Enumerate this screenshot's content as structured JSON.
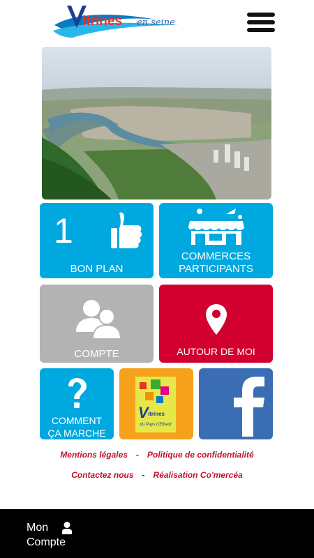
{
  "header": {
    "logo": {
      "brand_letters": [
        "V",
        "itrines"
      ],
      "tagline": "en seine"
    },
    "menu_icon": "hamburger-menu-icon"
  },
  "hero": {
    "image": "aerial-view-seine-valley"
  },
  "tiles": {
    "bon_plan": {
      "number": "1",
      "label": "BON PLAN",
      "icon": "thumbs-up-icon",
      "color": "#00a8e0"
    },
    "commerces": {
      "label_line1": "COMMERCES",
      "label_line2": "PARTICIPANTS",
      "icon": "shops-icon",
      "color": "#00a8e0"
    },
    "compte": {
      "label": "COMPTE",
      "icon": "users-icon",
      "color": "#b3b3b3"
    },
    "autour": {
      "label": "AUTOUR DE MOI",
      "icon": "map-pin-icon",
      "color": "#d2002e"
    },
    "comment": {
      "label_line1": "COMMENT",
      "label_line2": "ÇA MARCHE",
      "icon": "question-mark-icon",
      "color": "#00a8e0"
    },
    "vitrines_pays": {
      "logo_initial": "V",
      "logo_text": "itrines",
      "logo_sub": "du Pays d'Elbeuf",
      "color": "#f6a11a"
    },
    "facebook": {
      "icon": "facebook-icon",
      "color": "#3b6db5"
    }
  },
  "links": {
    "mentions": "Mentions légales",
    "sep": "-",
    "privacy": "Politique de confidentialité",
    "contact": "Contactez nous",
    "credits": "Réalisation Co'mercéa"
  },
  "bottom_bar": {
    "account_line1": "Mon",
    "account_line2": "Compte",
    "icon": "user-icon"
  }
}
